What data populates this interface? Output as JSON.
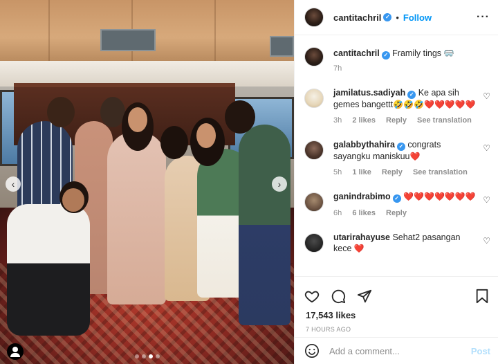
{
  "post": {
    "username": "cantitachril",
    "follow_label": "Follow",
    "separator": "•",
    "more_icon": "more-horizontal-icon",
    "caption_text": "Framily tings",
    "caption_emoji": "🥽",
    "caption_time": "7h",
    "photo_count": 4,
    "active_photo": 2
  },
  "comments": [
    {
      "username": "jamilatus.sadiyah",
      "verified": true,
      "text": "Ke apa sih gemes bangettt",
      "emojis": "🤣🤣🤣",
      "hearts": "❤️❤️❤️❤️❤️",
      "time": "3h",
      "likes": "2 likes",
      "reply": "Reply",
      "translate": "See translation"
    },
    {
      "username": "galabbythahira",
      "verified": true,
      "text": "congrats sayangku maniskuu",
      "hearts": "❤️",
      "time": "5h",
      "likes": "1 like",
      "reply": "Reply",
      "translate": "See translation"
    },
    {
      "username": "ganindrabimo",
      "verified": true,
      "hearts": "❤️❤️❤️❤️❤️❤️❤️",
      "time": "6h",
      "likes": "6 likes",
      "reply": "Reply"
    },
    {
      "username": "utarirahayuse",
      "text": "Sehat2 pasangan kece",
      "hearts": "❤️"
    }
  ],
  "actions": {
    "like_icon": "heart-icon",
    "comment_icon": "comment-icon",
    "share_icon": "share-icon",
    "save_icon": "bookmark-icon",
    "likes": "17,543 likes",
    "posted_ago": "7 HOURS AGO"
  },
  "composer": {
    "emoji_icon": "smiley-icon",
    "placeholder": "Add a comment...",
    "post_label": "Post"
  },
  "colors": {
    "accent": "#0095f6",
    "verified": "#3897f0",
    "post_disabled": "#b2dffc",
    "heart": "#ed4956"
  }
}
